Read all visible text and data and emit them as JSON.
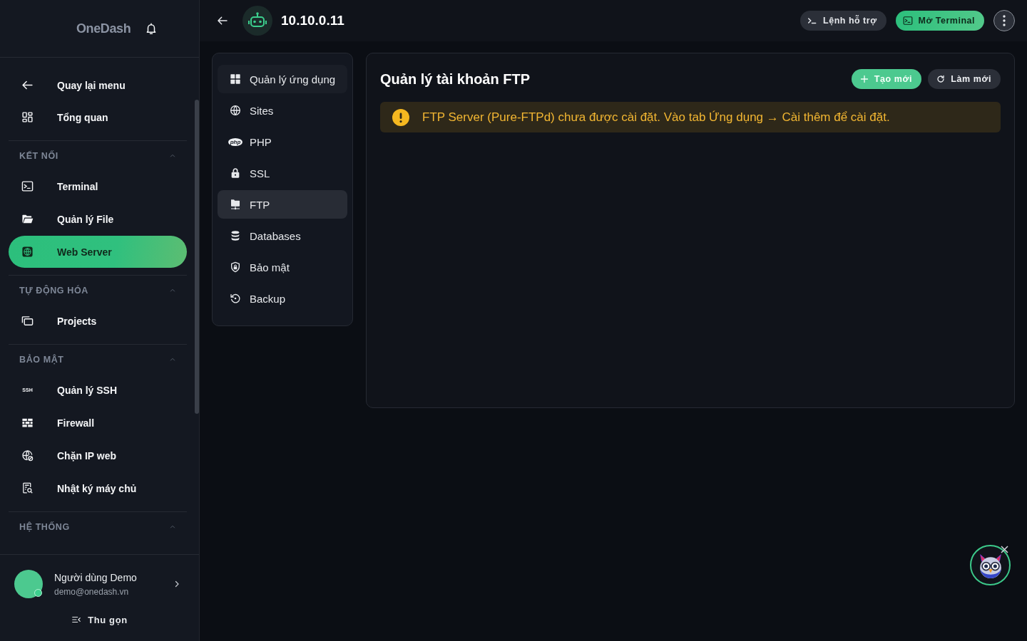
{
  "sidebar": {
    "logo": "OneDash",
    "nav": [
      {
        "label": "Quay lại menu",
        "kind": "back",
        "selected": false
      },
      {
        "label": "Tổng quan",
        "kind": "overview",
        "selected": false
      }
    ],
    "sections": [
      {
        "title": "KẾT NỐI",
        "expanded": true,
        "items": [
          {
            "label": "Terminal",
            "kind": "terminal",
            "selected": false
          },
          {
            "label": "Quản lý File",
            "kind": "files",
            "selected": false
          },
          {
            "label": "Web Server",
            "kind": "web",
            "selected": true
          }
        ]
      },
      {
        "title": "TỰ ĐỘNG HÓA",
        "expanded": true,
        "items": [
          {
            "label": "Projects",
            "kind": "projects",
            "selected": false
          }
        ]
      },
      {
        "title": "BẢO MẬT",
        "expanded": true,
        "items": [
          {
            "label": "Quản lý SSH",
            "kind": "ssh",
            "icon_text": "SSH",
            "selected": false
          },
          {
            "label": "Firewall",
            "kind": "firewall",
            "selected": false
          },
          {
            "label": "Chặn IP web",
            "kind": "ipblock",
            "selected": false
          },
          {
            "label": "Nhật ký máy chủ",
            "kind": "logs",
            "selected": false
          }
        ]
      },
      {
        "title": "HỆ THỐNG",
        "expanded": true
      }
    ],
    "user": {
      "name": "Người dùng Demo",
      "email": "demo@onedash.vn",
      "online": true
    },
    "collapse": "Thu gọn"
  },
  "header": {
    "title": "10.10.0.11",
    "actions": [
      {
        "label": "Lệnh hỗ trợ",
        "kind": "commands"
      },
      {
        "label": "Mở Terminal",
        "kind": "terminal"
      }
    ]
  },
  "app_menu": {
    "items": [
      {
        "label": "Quản lý ứng dụng",
        "kind": "apps",
        "selected": false
      },
      {
        "label": "Sites",
        "kind": "sites",
        "selected": false
      },
      {
        "label": "PHP",
        "kind": "php",
        "icon_text": "php",
        "selected": false
      },
      {
        "label": "SSL",
        "kind": "ssl",
        "selected": false
      },
      {
        "label": "FTP",
        "kind": "ftp",
        "selected": true
      },
      {
        "label": "Databases",
        "kind": "databases",
        "selected": false
      },
      {
        "label": "Bảo mật",
        "kind": "security",
        "selected": false
      },
      {
        "label": "Backup",
        "kind": "backup",
        "selected": false
      }
    ]
  },
  "panel": {
    "title": "Quản lý tài khoản FTP",
    "actions": [
      {
        "label": "Tạo mới",
        "kind": "create"
      },
      {
        "label": "Làm mới",
        "kind": "refresh"
      }
    ],
    "alert": {
      "kind": "warning",
      "text": "FTP Server (Pure-FTPd) chưa được cài đặt. Vào tab Ứng dụng → Cài thêm để cài đặt."
    }
  }
}
